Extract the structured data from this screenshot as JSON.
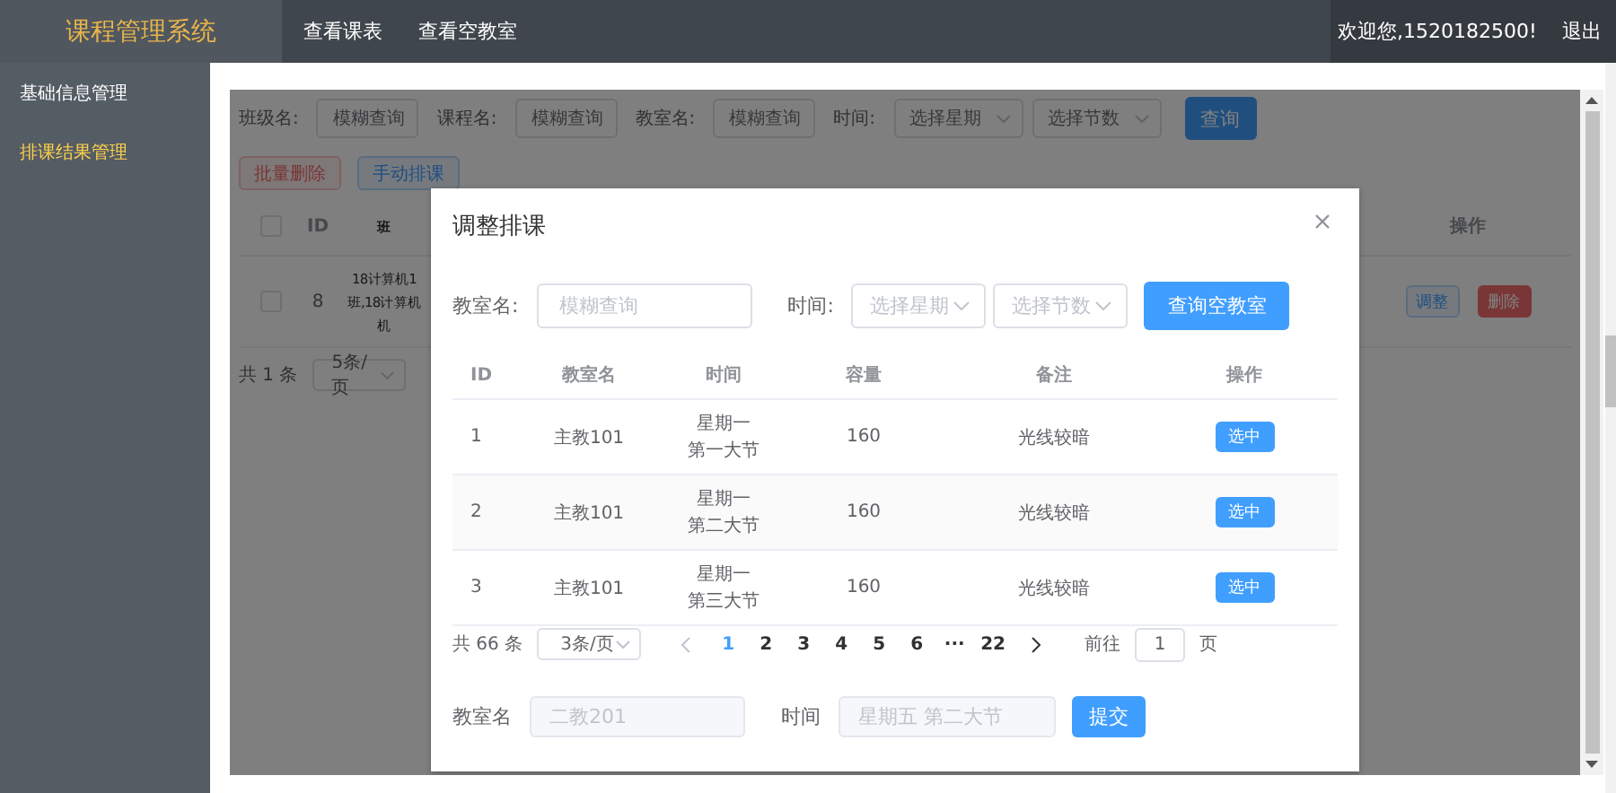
{
  "app": {
    "title": "课程管理系统",
    "nav": [
      {
        "label": "查看课表"
      },
      {
        "label": "查看空教室"
      }
    ],
    "welcome": "欢迎您,1520182500!",
    "logout": "退出"
  },
  "sidebar": {
    "items": [
      {
        "label": "基础信息管理",
        "selected": false
      },
      {
        "label": "排课结果管理",
        "selected": true
      }
    ]
  },
  "page": {
    "filters": [
      {
        "kind": "input",
        "label": "班级名:",
        "placeholder": "模糊查询"
      },
      {
        "kind": "input",
        "label": "课程名:",
        "placeholder": "模糊查询"
      },
      {
        "kind": "input",
        "label": "教室名:",
        "placeholder": "模糊查询"
      },
      {
        "kind": "selects",
        "label": "时间:",
        "options": [
          "选择星期",
          "选择节数"
        ]
      }
    ],
    "search_button": "查询",
    "actions": [
      {
        "label": "批量删除",
        "kind": "danger"
      },
      {
        "label": "手动排课",
        "kind": "primary"
      }
    ],
    "table": {
      "select_all_checked": false,
      "columns": [
        "ID",
        "班",
        "操作"
      ],
      "rows": [
        {
          "checked": false,
          "id": "8",
          "class_lines": [
            "18计算机1",
            "班,18计算机",
            "机"
          ],
          "actions": [
            {
              "label": "调整",
              "kind": "primary"
            },
            {
              "label": "删除",
              "kind": "danger"
            }
          ]
        }
      ]
    },
    "pagination": {
      "total": "共 1 条",
      "page_size": "5条/页"
    }
  },
  "dialog": {
    "title": "调整排课",
    "filters": {
      "room_label": "教室名:",
      "room_placeholder": "模糊查询",
      "time_label": "时间:",
      "selects": [
        "选择星期",
        "选择节数"
      ],
      "button": "查询空教室"
    },
    "table": {
      "columns": [
        "ID",
        "教室名",
        "时间",
        "容量",
        "备注",
        "操作"
      ],
      "rows": [
        {
          "id": "1",
          "room": "主教101",
          "time": [
            "星期一",
            "第一大节"
          ],
          "capacity": "160",
          "note": "光线较暗",
          "action": "选中"
        },
        {
          "id": "2",
          "room": "主教101",
          "time": [
            "星期一",
            "第二大节"
          ],
          "capacity": "160",
          "note": "光线较暗",
          "action": "选中"
        },
        {
          "id": "3",
          "room": "主教101",
          "time": [
            "星期一",
            "第三大节"
          ],
          "capacity": "160",
          "note": "光线较暗",
          "action": "选中"
        }
      ]
    },
    "pagination": {
      "total": "共 66 条",
      "page_size": "3条/页",
      "pages": [
        {
          "label": "1",
          "selected": true
        },
        {
          "label": "2",
          "selected": false
        },
        {
          "label": "3",
          "selected": false
        },
        {
          "label": "4",
          "selected": false
        },
        {
          "label": "5",
          "selected": false
        },
        {
          "label": "6",
          "selected": false
        },
        {
          "label": "···",
          "selected": false
        },
        {
          "label": "22",
          "selected": false
        }
      ],
      "goto_label": "前往",
      "goto_value": "1",
      "goto_unit": "页"
    },
    "form": {
      "room_label": "教室名",
      "room_value": "二教201",
      "time_label": "时间",
      "time_value": "星期五 第二大节",
      "submit": "提交"
    }
  }
}
